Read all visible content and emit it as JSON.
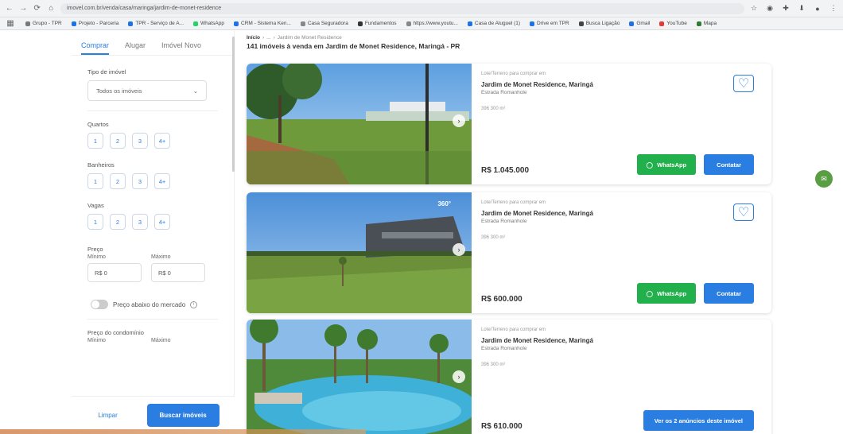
{
  "browser": {
    "url": "imovel.com.br/venda/casa/maringa/jardim-de-monet-residence",
    "bookmarks": [
      "Grupo - TPR",
      "Projeto - Parceria",
      "TPR - Serviço de A...",
      "WhatsApp",
      "CRM - Sistema Ken...",
      "Casa Seguradora",
      "Fundamentos",
      "https://www.youtu...",
      "Casa de Aluguel (1)",
      "Drive em TPR",
      "Busca Ligação",
      "Gmail",
      "YouTube",
      "Mapa"
    ]
  },
  "sidebar": {
    "tabs": [
      "Comprar",
      "Alugar",
      "Imóvel Novo"
    ],
    "type_label": "Tipo de imóvel",
    "type_value": "Todos os imóveis",
    "rooms_label": "Quartos",
    "baths_label": "Banheiros",
    "parking_label": "Vagas",
    "chips": [
      "1",
      "2",
      "3",
      "4+"
    ],
    "price_label": "Preço",
    "min_label": "Mínimo",
    "max_label": "Máximo",
    "min_placeholder": "R$ 0",
    "max_placeholder": "R$ 0",
    "below_market_label": "Preço abaixo do mercado",
    "condo_label": "Preço do condomínio",
    "clear_label": "Limpar",
    "search_label": "Buscar imóveis"
  },
  "main": {
    "breadcrumb": [
      "Início",
      "...",
      "Jardim de Monet Residence"
    ],
    "heading": "141 imóveis à venda em Jardim de Monet Residence, Maringá - PR",
    "listings": [
      {
        "tag": "Lote/Terreno para comprar em",
        "title": "Jardim de Monet Residence, Maringá",
        "street": "Estrada Romanhole",
        "area": "396 300 m²",
        "price": "R$ 1.045.000",
        "wa_label": "WhatsApp",
        "contact_label": "Contatar"
      },
      {
        "tag": "Lote/Terreno para comprar em",
        "title": "Jardim de Monet Residence, Maringá",
        "street": "Estrada Romanhole",
        "area": "396 300 m²",
        "price": "R$ 600.000",
        "wa_label": "WhatsApp",
        "contact_label": "Contatar"
      },
      {
        "tag": "Lote/Terreno para comprar em",
        "title": "Jardim de Monet Residence, Maringá",
        "street": "Estrada Romanhole",
        "area": "396 300 m²",
        "price": "R$ 610.000",
        "more_label": "Ver os 2 anúncios deste imóvel"
      }
    ]
  },
  "colors": {
    "accent": "#2a7de1",
    "whatsapp": "#22b04c"
  }
}
